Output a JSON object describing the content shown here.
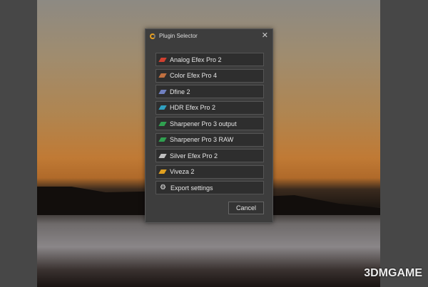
{
  "dialog": {
    "title": "Plugin Selector",
    "close": "✕",
    "plugins": [
      {
        "label": "Analog Efex Pro 2",
        "color": "#d04030"
      },
      {
        "label": "Color Efex Pro 4",
        "color": "#c07040"
      },
      {
        "label": "Dfine 2",
        "color": "#7080c0"
      },
      {
        "label": "HDR Efex Pro 2",
        "color": "#30a0c0"
      },
      {
        "label": "Sharpener Pro 3 output",
        "color": "#30a050"
      },
      {
        "label": "Sharpener Pro 3 RAW",
        "color": "#30a050"
      },
      {
        "label": "Silver Efex Pro 2",
        "color": "#c0c0c0"
      },
      {
        "label": "Viveza 2",
        "color": "#e0a020"
      }
    ],
    "export": "Export settings",
    "cancel": "Cancel"
  },
  "watermark": "3DMGAME"
}
